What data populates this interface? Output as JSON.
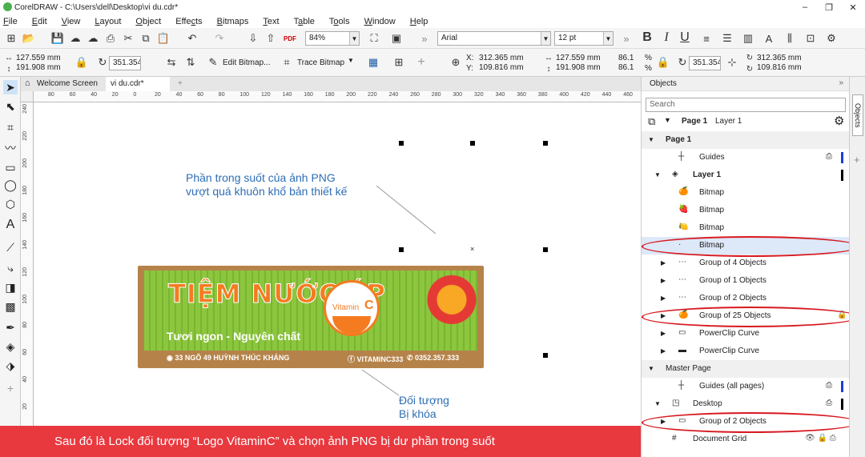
{
  "window": {
    "title": "CorelDRAW - C:\\Users\\dell\\Desktop\\vi du.cdr*",
    "minimize": "–",
    "restore": "❐",
    "close": "✕"
  },
  "menu": [
    {
      "pre": "",
      "u": "F",
      "post": "ile"
    },
    {
      "pre": "",
      "u": "E",
      "post": "dit"
    },
    {
      "pre": "",
      "u": "V",
      "post": "iew"
    },
    {
      "pre": "",
      "u": "L",
      "post": "ayout"
    },
    {
      "pre": "",
      "u": "O",
      "post": "bject"
    },
    {
      "pre": "Effe",
      "u": "c",
      "post": "ts"
    },
    {
      "pre": "",
      "u": "B",
      "post": "itmaps"
    },
    {
      "pre": "",
      "u": "T",
      "post": "ext"
    },
    {
      "pre": "T",
      "u": "a",
      "post": "ble"
    },
    {
      "pre": "T",
      "u": "o",
      "post": "ols"
    },
    {
      "pre": "",
      "u": "W",
      "post": "indow"
    },
    {
      "pre": "",
      "u": "H",
      "post": "elp"
    }
  ],
  "toolbar1": {
    "zoom": "84%",
    "font": "Arial",
    "size": "12 pt",
    "pdf": "PDF",
    "bold": "B",
    "italic": "I",
    "underline": "U"
  },
  "toolbar2": {
    "w1": "127.559 mm",
    "h1": "191.908 mm",
    "angle1": "351.354",
    "edit_bitmap": "Edit Bitmap...",
    "trace_bitmap": "Trace Bitmap",
    "x": "312.365 mm",
    "y": "109.816 mm",
    "xl": "X:",
    "yl": "Y:",
    "w2": "127.559 mm",
    "h2": "191.908 mm",
    "sx": "86.1",
    "sy": "86.1",
    "pct": "%",
    "angle2": "351.354",
    "cx": "312.365 mm",
    "cy": "109.816 mm"
  },
  "tabs": {
    "welcome": "Welcome Screen",
    "doc": "vi du.cdr*",
    "add": "+"
  },
  "canvas": {
    "note1_line1": "Phần trong suốt của ảnh PNG",
    "note1_line2": "vượt quá khuôn khổ bản thiết kế",
    "note2_line1": "Đối tượng",
    "note2_line2": "Bị khóa"
  },
  "banner": {
    "title": "TIỆM NƯỚC ÉP",
    "subtitle": "Tươi ngon - Nguyên chất",
    "address": "33 NGÕ 49 HUỲNH THÚC KHÁNG",
    "facebook": "VITAMINC333",
    "phone": "0352.357.333",
    "logo_a": "Vitamin",
    "logo_b": "C"
  },
  "panel": {
    "title": "Objects",
    "search_placeholder": "Search",
    "page_label": "Page 1",
    "layer_label": "Layer 1",
    "side_tab": "Objects",
    "rows": [
      {
        "label": "Page 1",
        "bold": true,
        "indent": 0,
        "expander": "▼"
      },
      {
        "label": "Guides",
        "bold": false,
        "indent": 2,
        "expander": ""
      },
      {
        "label": "Layer 1",
        "bold": true,
        "indent": 1,
        "expander": "▼"
      },
      {
        "label": "Bitmap",
        "bold": false,
        "indent": 2,
        "expander": ""
      },
      {
        "label": "Bitmap",
        "bold": false,
        "indent": 2,
        "expander": ""
      },
      {
        "label": "Bitmap",
        "bold": false,
        "indent": 2,
        "expander": ""
      },
      {
        "label": "Bitmap",
        "bold": false,
        "indent": 2,
        "expander": ""
      },
      {
        "label": "Group of 4 Objects",
        "bold": false,
        "indent": 2,
        "expander": "▶"
      },
      {
        "label": "Group of 1 Objects",
        "bold": false,
        "indent": 2,
        "expander": "▶"
      },
      {
        "label": "Group of 2 Objects",
        "bold": false,
        "indent": 2,
        "expander": "▶"
      },
      {
        "label": "Group of 25 Objects",
        "bold": false,
        "indent": 2,
        "expander": "▶"
      },
      {
        "label": "PowerClip Curve",
        "bold": false,
        "indent": 2,
        "expander": "▶"
      },
      {
        "label": "PowerClip Curve",
        "bold": false,
        "indent": 2,
        "expander": "▶"
      },
      {
        "label": "Master Page",
        "bold": false,
        "indent": 0,
        "expander": "▼"
      },
      {
        "label": "Guides (all pages)",
        "bold": false,
        "indent": 2,
        "expander": ""
      },
      {
        "label": "Desktop",
        "bold": false,
        "indent": 1,
        "expander": "▼"
      },
      {
        "label": "Group of 2 Objects",
        "bold": false,
        "indent": 2,
        "expander": "▶"
      },
      {
        "label": "Document Grid",
        "bold": false,
        "indent": 1,
        "expander": ""
      }
    ]
  },
  "caption": "Sau đó là Lock đối tượng “Logo VitaminC” và chọn ảnh PNG bị dư phần trong suốt",
  "colors": {
    "accent": "#d71920",
    "banner_green": "#8cc63f",
    "banner_orange": "#f47b20",
    "caption_bg": "#e8393f",
    "selected_row": "#dde8f8"
  },
  "ruler_h": [
    "80",
    "60",
    "40",
    "20",
    "0",
    "20",
    "40",
    "60",
    "80",
    "100",
    "120",
    "140",
    "160",
    "180",
    "200",
    "220",
    "240",
    "260",
    "280",
    "300",
    "320",
    "340",
    "360",
    "380",
    "400",
    "420",
    "440",
    "460",
    "480"
  ],
  "ruler_v": [
    "240",
    "220",
    "200",
    "180",
    "160",
    "140",
    "120",
    "100",
    "80",
    "60",
    "40",
    "20"
  ]
}
